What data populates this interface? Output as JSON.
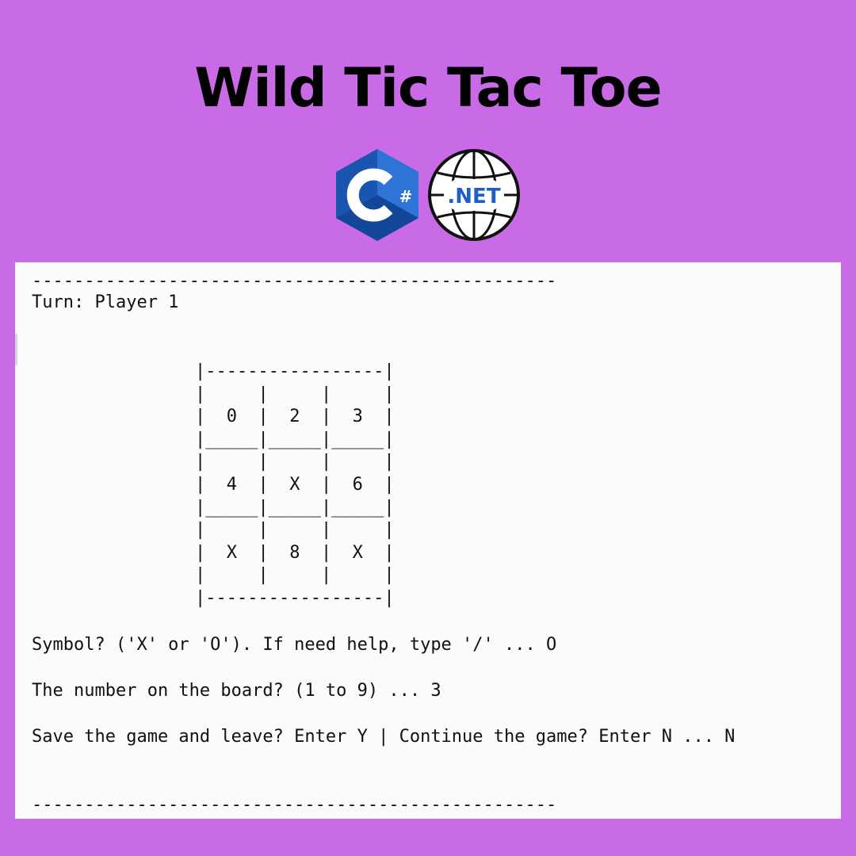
{
  "title": "Wild Tic Tac Toe",
  "logos": {
    "csharp": {
      "icon": "csharp-logo-icon",
      "text": "C#",
      "color": "#1f5fbf"
    },
    "dotnet": {
      "icon": "dotnet-globe-logo-icon",
      "text": ".NET",
      "color": "#1d5fc4"
    }
  },
  "terminal": {
    "separator_top": "--------------------------------------------------",
    "turn_text": "Turn: Player 1",
    "board": {
      "cells": [
        "0",
        "2",
        "3",
        "4",
        "X",
        "6",
        "X",
        "8",
        "X"
      ],
      "rows": [
        "|-----------------|",
        "|     |     |     |",
        "|  0  |  2  |  3  |",
        "|_____|_____|_____|",
        "|     |     |     |",
        "|  4  |  X  |  6  |",
        "|_____|_____|_____|",
        "|     |     |     |",
        "|  X  |  8  |  X  |",
        "|     |     |     |",
        "|-----------------|"
      ]
    },
    "prompt_symbol": "Symbol? ('X' or 'O'). If need help, type '/' ... O",
    "prompt_number": "The number on the board? (1 to 9) ... 3",
    "prompt_save": "Save the game and leave? Enter Y | Continue the game? Enter N ... N",
    "separator_bottom": "--------------------------------------------------"
  },
  "colors": {
    "background": "#c96ae6",
    "terminal_bg": "#fbfbfb",
    "text": "#111111"
  }
}
